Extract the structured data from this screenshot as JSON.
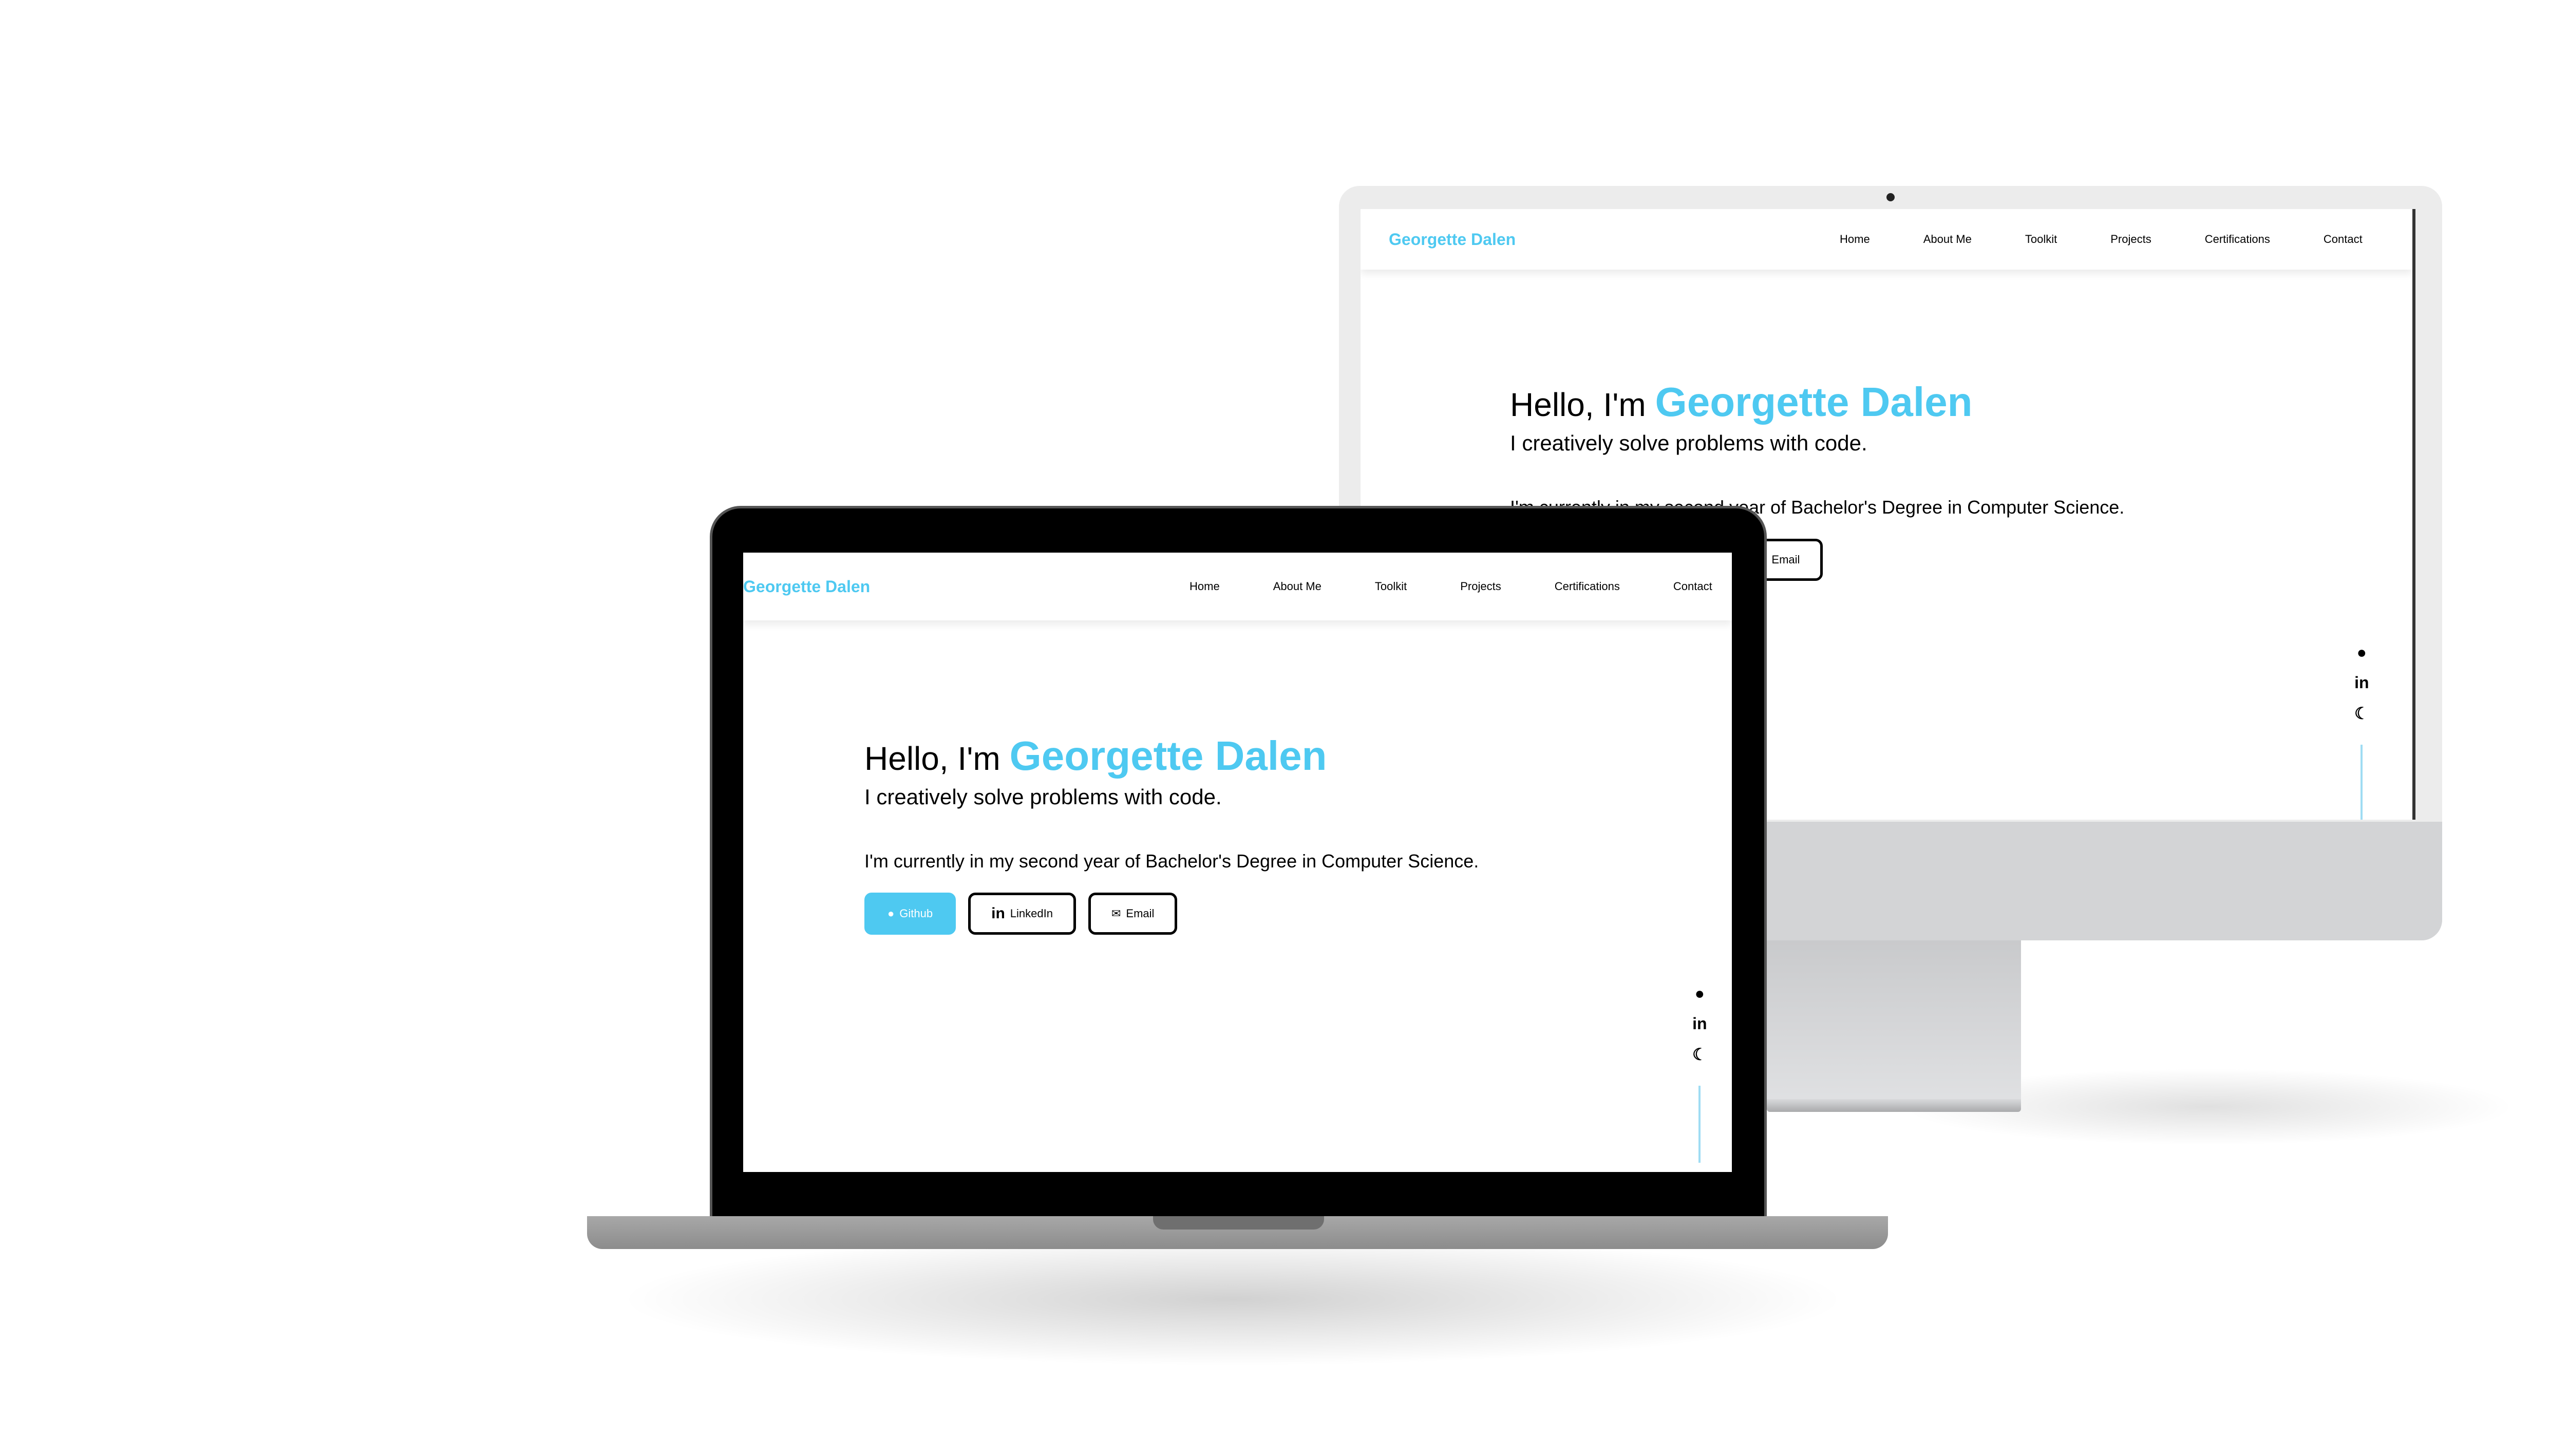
{
  "site": {
    "logo": "Georgette Dalen",
    "nav": [
      "Home",
      "About Me",
      "Toolkit",
      "Projects",
      "Certifications",
      "Contact"
    ],
    "greeting": "Hello, I'm",
    "name": "Georgette Dalen",
    "tagline": "I creatively solve problems with code.",
    "intro": "I'm currently in my second year of Bachelor's Degree in Computer Science.",
    "buttons": {
      "github": "Github",
      "linkedin": "LinkedIn",
      "email": "Email"
    },
    "icons": {
      "github": "github-icon",
      "linkedin": "linkedin-icon",
      "theme": "moon-icon",
      "email": "envelope-icon"
    }
  },
  "colors": {
    "accent": "#4ec9f1",
    "text": "#000000"
  }
}
